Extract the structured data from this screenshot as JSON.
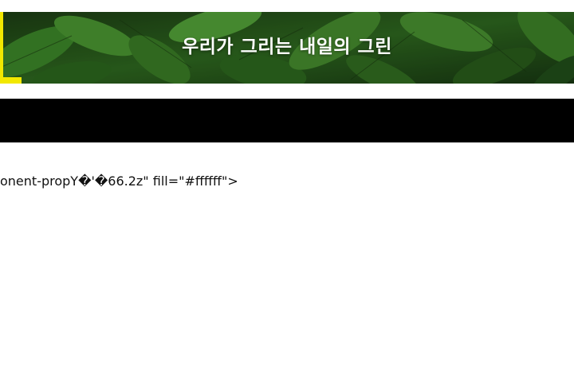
{
  "hero": {
    "title": "우리가 그리는 내일의 그린",
    "background_image": "tropical-leaves-image",
    "accent_color": "#f2e800"
  },
  "nav_bar": {
    "color": "#000000"
  },
  "content": {
    "broken_text": "onent-propY�'�66.2z\" fill=\"#ffffff\">"
  }
}
